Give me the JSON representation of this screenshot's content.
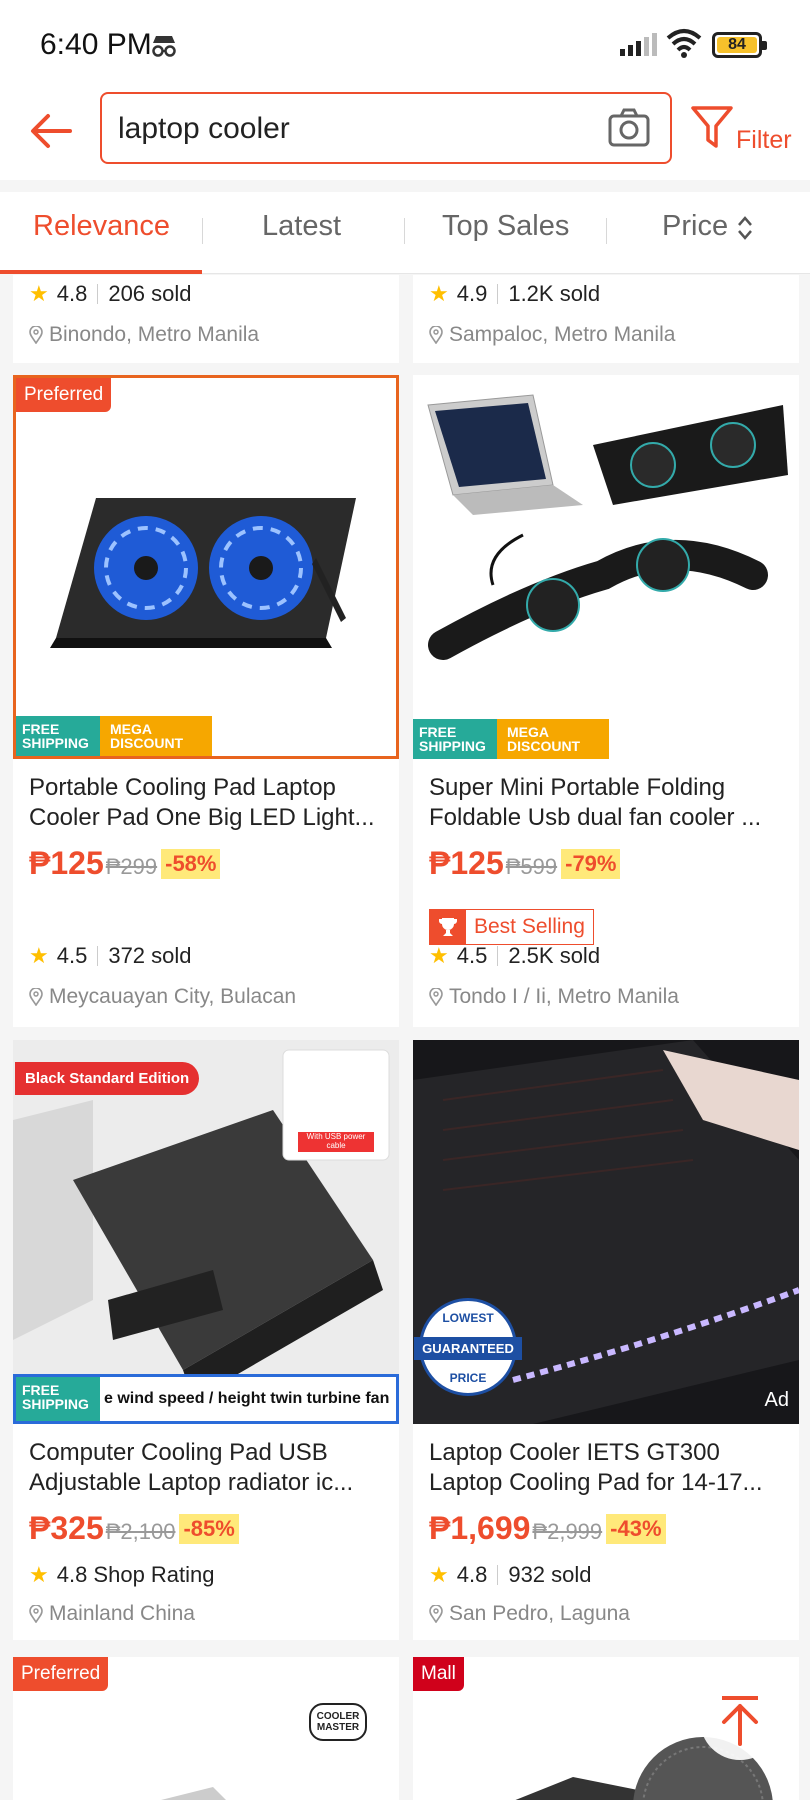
{
  "status": {
    "time": "6:40 PM",
    "battery": "84"
  },
  "search": {
    "query": "laptop cooler"
  },
  "filter_label": "Filter",
  "tabs": [
    {
      "label": "Relevance"
    },
    {
      "label": "Latest"
    },
    {
      "label": "Top Sales"
    },
    {
      "label": "Price"
    }
  ],
  "top_row": [
    {
      "rating": "4.8",
      "sold": "206 sold",
      "location": "Binondo, Metro Manila"
    },
    {
      "rating": "4.9",
      "sold": "1.2K sold",
      "location": "Sampaloc, Metro Manila"
    }
  ],
  "products": [
    {
      "badge": "Preferred",
      "free_shipping": "FREE SHIPPING",
      "mega": "MEGA DISCOUNT",
      "title_line1": "Portable Cooling Pad Laptop",
      "title_line2": "Cooler Pad One Big LED Light...",
      "price": "₱125",
      "orig_price": "₱299",
      "discount": "-58%",
      "rating": "4.5",
      "sold": "372 sold",
      "location": "Meycauayan City, Bulacan"
    },
    {
      "free_shipping": "FREE SHIPPING",
      "mega": "MEGA DISCOUNT",
      "title_line1": "Super Mini Portable Folding",
      "title_line2": "Foldable Usb dual fan cooler ...",
      "price": "₱125",
      "orig_price": "₱599",
      "discount": "-79%",
      "best_selling": "Best Selling",
      "rating": "4.5",
      "sold": "2.5K sold",
      "location": "Tondo I / Ii, Metro Manila"
    },
    {
      "edition": "Black Standard Edition",
      "usb_note": "With USB power cable",
      "free_shipping": "FREE SHIPPING",
      "banner_text": "e wind speed / height twin turbine fan",
      "title_line1": "Computer Cooling Pad USB",
      "title_line2": "Adjustable Laptop radiator ic...",
      "price": "₱325",
      "orig_price": "₱2,100",
      "discount": "-85%",
      "shop_rating": "4.8 Shop Rating",
      "location": "Mainland China"
    },
    {
      "guarantee_top": "LOWEST",
      "guarantee_mid": "GUARANTEED",
      "guarantee_bot": "PRICE",
      "ad": "Ad",
      "title_line1": "Laptop Cooler IETS GT300",
      "title_line2": "Laptop Cooling Pad for 14-17...",
      "price": "₱1,699",
      "orig_price": "₱2,999",
      "discount": "-43%",
      "rating": "4.8",
      "sold": "932 sold",
      "location": "San Pedro, Laguna"
    }
  ],
  "bottom_row": [
    {
      "badge": "Preferred",
      "brand_logo": "COOLER MASTER"
    },
    {
      "badge": "Mall"
    }
  ],
  "colors": {
    "accent": "#ee4d2d",
    "shipping": "#26aa99",
    "mega": "#f6a700",
    "star": "#ffbf00"
  }
}
